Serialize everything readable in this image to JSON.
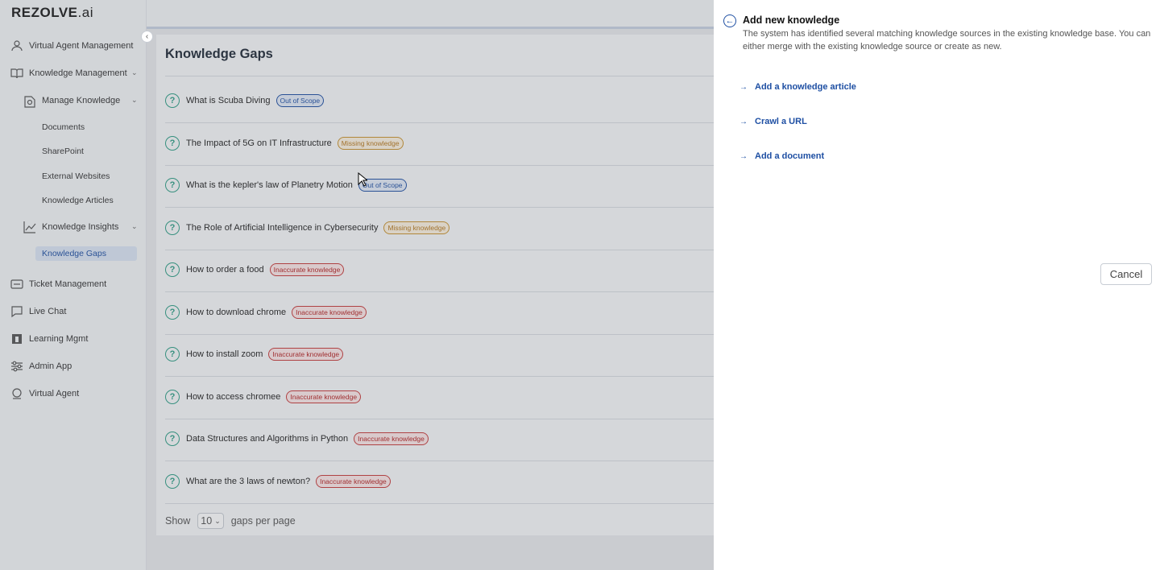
{
  "app": {
    "logo_main": "REZOLVE",
    "logo_suffix": ".ai"
  },
  "sidebar": {
    "items": [
      {
        "label": "Virtual Agent Management",
        "icon": "agent-management-icon"
      },
      {
        "label": "Knowledge Management",
        "icon": "book-icon"
      },
      {
        "label": "Manage Knowledge",
        "icon": "manage-knowledge-icon"
      },
      {
        "label": "Knowledge Insights",
        "icon": "insights-chart-icon"
      },
      {
        "label": "Ticket Management",
        "icon": "ticket-icon"
      },
      {
        "label": "Live Chat",
        "icon": "chat-icon"
      },
      {
        "label": "Learning Mgmt",
        "icon": "learning-icon"
      },
      {
        "label": "Admin App",
        "icon": "admin-sliders-icon"
      },
      {
        "label": "Virtual Agent",
        "icon": "virtual-agent-icon"
      }
    ],
    "sub_items": [
      "Documents",
      "SharePoint",
      "External Websites",
      "Knowledge Articles"
    ],
    "active_item": "Knowledge Gaps"
  },
  "main": {
    "title": "Knowledge Gaps",
    "gaps": [
      {
        "title": "What is Scuba Diving",
        "badge": "Out of Scope"
      },
      {
        "title": "The Impact of 5G on IT Infrastructure",
        "badge": "Missing knowledge"
      },
      {
        "title": "What is the kepler's law of Planetry Motion",
        "badge": "Out of Scope"
      },
      {
        "title": "The Role of Artificial Intelligence in Cybersecurity",
        "badge": "Missing knowledge"
      },
      {
        "title": "How to order a food",
        "badge": "Inaccurate knowledge"
      },
      {
        "title": "How to download chrome",
        "badge": "Inaccurate knowledge"
      },
      {
        "title": "How to install zoom",
        "badge": "Inaccurate knowledge"
      },
      {
        "title": "How to access chromee",
        "badge": "Inaccurate knowledge"
      },
      {
        "title": "Data Structures and Algorithms in Python",
        "badge": "Inaccurate knowledge"
      },
      {
        "title": "What are the 3 laws of newton?",
        "badge": "Inaccurate knowledge"
      }
    ],
    "pagination": {
      "show_label": "Show",
      "page_size": "10",
      "suffix": "gaps per page"
    }
  },
  "panel": {
    "title": "Add new knowledge",
    "description": "The system has identified several matching knowledge sources in the existing knowledge base. You can either merge with the existing knowledge source or create as new.",
    "options": [
      "Add a knowledge article",
      "Crawl a URL",
      "Add a document"
    ],
    "cancel_label": "Cancel"
  },
  "colors": {
    "accent": "#1e4fa3",
    "out_of_scope": "#1e4fa3",
    "missing": "#c9922e",
    "inaccurate": "#c73a3a",
    "gap_icon": "#2e9e86"
  }
}
